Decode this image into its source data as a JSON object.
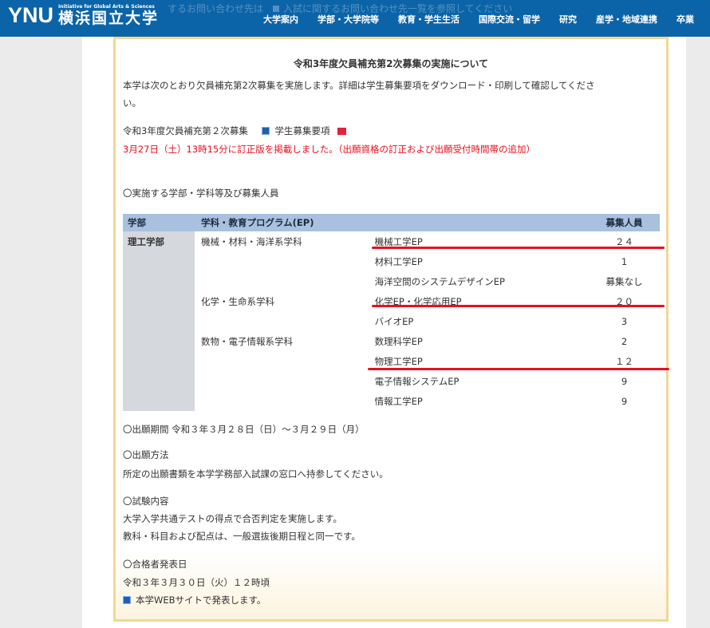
{
  "header": {
    "ghost_text": [
      "するお問い合わせ先は",
      "入試に関するお問い合わせ先一覧を参照してください"
    ],
    "logo_mark": "YNU",
    "logo_tagline": "Initiative for Global Arts & Sciences",
    "logo_name": "横浜国立大学",
    "nav": [
      "大学案内",
      "学部・大学院等",
      "教育・学生生活",
      "国際交流・留学",
      "研究",
      "産学・地域連携",
      "卒業"
    ]
  },
  "article": {
    "title": "令和3年度欠員補充第2次募集の実施について",
    "intro_line1": "本学は次のとおり欠員補充第2次募集を実施します。詳細は学生募集要項をダウンロード・印刷して確認してくださ",
    "intro_line2": "い。",
    "link_prefix": "令和3年度欠員補充第２次募集",
    "link_label": "学生募集要項",
    "notice": "3月27日（土）13時15分に訂正版を掲載しました。（出願資格の訂正および出願受付時間帯の追加）",
    "table_heading": "〇実施する学部・学科等及び募集人員",
    "table": {
      "headers": [
        "学部",
        "学科・教育プログラム(EP)",
        "募集人員"
      ],
      "faculty": "理工学部",
      "rows": [
        {
          "dept": "機械・材料・海洋系学科",
          "program": "機械工学EP",
          "count": "２４"
        },
        {
          "dept": "",
          "program": "材料工学EP",
          "count": "1"
        },
        {
          "dept": "",
          "program": "海洋空間のシステムデザインEP",
          "count": "募集なし"
        },
        {
          "dept": "化学・生命系学科",
          "program": "化学EP・化学応用EP",
          "count": "２０"
        },
        {
          "dept": "",
          "program": "バイオEP",
          "count": "3"
        },
        {
          "dept": "数物・電子情報系学科",
          "program": "数理科学EP",
          "count": "2"
        },
        {
          "dept": "",
          "program": "物理工学EP",
          "count": "１２"
        },
        {
          "dept": "",
          "program": "電子情報システムEP",
          "count": "9"
        },
        {
          "dept": "",
          "program": "情報工学EP",
          "count": "9"
        }
      ]
    },
    "application_period": "〇出願期間 令和３年３月２８日（日）～３月２９日（月）",
    "method_heading": "〇出願方法",
    "method_text": "所定の出願書類を本学学務部入試課の窓口へ持参してください。",
    "exam_heading": "〇試験内容",
    "exam_line1": "大学入学共通テストの得点で合否判定を実施します。",
    "exam_line2": "教科・科目および配点は、一般選抜後期日程と同一です。",
    "announce_heading": "〇合格者発表日",
    "announce_date": "令和３年３月３０日（火）１２時頃",
    "announce_web": "本学WEBサイトで発表します。"
  },
  "colors": {
    "header_blue": "#0c64a8",
    "table_header": "#a9c0df",
    "faculty_cell": "#d5d8dd",
    "box_border": "#f2d896",
    "notice_red": "#e8101e",
    "annotation_red": "#e8101e"
  }
}
